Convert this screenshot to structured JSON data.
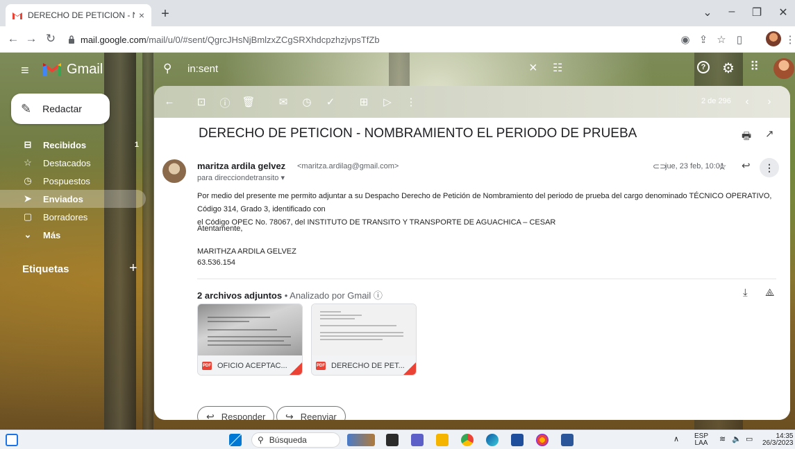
{
  "browser": {
    "tab_title": "DERECHO DE PETICION - NOMB",
    "tab_close": "×",
    "new_tab": "+",
    "url_host": "mail.google.com",
    "url_path": "/mail/u/0/#sent/QgrcJHsNjBmlzxZCgSRXhdcpzhzjvpsTfZb"
  },
  "gmail": {
    "app_name": "Gmail",
    "search_value": "in:sent",
    "compose_label": "Redactar",
    "nav": [
      {
        "label": "Recibidos",
        "count": "1"
      },
      {
        "label": "Destacados"
      },
      {
        "label": "Pospuestos"
      },
      {
        "label": "Enviados"
      },
      {
        "label": "Borradores"
      },
      {
        "label": "Más"
      }
    ],
    "labels_heading": "Etiquetas",
    "pagination": "2 de 296"
  },
  "message": {
    "subject": "DERECHO DE PETICION - NOMBRAMIENTO EL PERIODO DE PRUEBA",
    "sender_name": "maritza ardila gelvez",
    "sender_email": "<maritza.ardilag@gmail.com>",
    "to_line": "para direcciondetransito ▾",
    "date": "jue, 23 feb, 10:01",
    "body_line1": "Por medio del presente me permito adjuntar a su Despacho Derecho de Petición de Nombramiento del periodo de prueba  del cargo denominado TÉCNICO OPERATIVO, Código 314, Grado 3, identificado con",
    "body_line2": "el Código OPEC No. 78067, del INSTITUTO DE TRANSITO Y TRANSPORTE DE AGUACHICA – CESAR",
    "greeting": "Atentamente,",
    "sign_name": "MARITHZA ARDILA GELVEZ",
    "sign_id": "63.536.154",
    "attachments_count_label": "2 archivos adjuntos",
    "attachments_scan": " •  Analizado por Gmail ⓘ",
    "attachments": [
      {
        "name": "OFICIO ACEPTAC..."
      },
      {
        "name": "DERECHO DE PET..."
      }
    ],
    "reply_label": "Responder",
    "forward_label": "Reenviar"
  },
  "taskbar": {
    "search_label": "Búsqueda",
    "lang": "ESP",
    "lang2": "LAA",
    "time": "14:35",
    "date": "26/3/2023"
  },
  "colors": {
    "gmail_red": "#ea4335",
    "accent_blue": "#0b57d0"
  }
}
